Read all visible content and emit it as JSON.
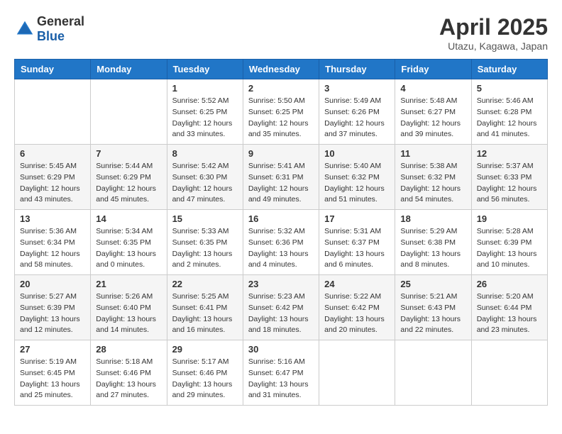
{
  "header": {
    "logo_general": "General",
    "logo_blue": "Blue",
    "title": "April 2025",
    "location": "Utazu, Kagawa, Japan"
  },
  "calendar": {
    "days_of_week": [
      "Sunday",
      "Monday",
      "Tuesday",
      "Wednesday",
      "Thursday",
      "Friday",
      "Saturday"
    ],
    "weeks": [
      [
        {
          "day": "",
          "info": ""
        },
        {
          "day": "",
          "info": ""
        },
        {
          "day": "1",
          "info": "Sunrise: 5:52 AM\nSunset: 6:25 PM\nDaylight: 12 hours\nand 33 minutes."
        },
        {
          "day": "2",
          "info": "Sunrise: 5:50 AM\nSunset: 6:25 PM\nDaylight: 12 hours\nand 35 minutes."
        },
        {
          "day": "3",
          "info": "Sunrise: 5:49 AM\nSunset: 6:26 PM\nDaylight: 12 hours\nand 37 minutes."
        },
        {
          "day": "4",
          "info": "Sunrise: 5:48 AM\nSunset: 6:27 PM\nDaylight: 12 hours\nand 39 minutes."
        },
        {
          "day": "5",
          "info": "Sunrise: 5:46 AM\nSunset: 6:28 PM\nDaylight: 12 hours\nand 41 minutes."
        }
      ],
      [
        {
          "day": "6",
          "info": "Sunrise: 5:45 AM\nSunset: 6:29 PM\nDaylight: 12 hours\nand 43 minutes."
        },
        {
          "day": "7",
          "info": "Sunrise: 5:44 AM\nSunset: 6:29 PM\nDaylight: 12 hours\nand 45 minutes."
        },
        {
          "day": "8",
          "info": "Sunrise: 5:42 AM\nSunset: 6:30 PM\nDaylight: 12 hours\nand 47 minutes."
        },
        {
          "day": "9",
          "info": "Sunrise: 5:41 AM\nSunset: 6:31 PM\nDaylight: 12 hours\nand 49 minutes."
        },
        {
          "day": "10",
          "info": "Sunrise: 5:40 AM\nSunset: 6:32 PM\nDaylight: 12 hours\nand 51 minutes."
        },
        {
          "day": "11",
          "info": "Sunrise: 5:38 AM\nSunset: 6:32 PM\nDaylight: 12 hours\nand 54 minutes."
        },
        {
          "day": "12",
          "info": "Sunrise: 5:37 AM\nSunset: 6:33 PM\nDaylight: 12 hours\nand 56 minutes."
        }
      ],
      [
        {
          "day": "13",
          "info": "Sunrise: 5:36 AM\nSunset: 6:34 PM\nDaylight: 12 hours\nand 58 minutes."
        },
        {
          "day": "14",
          "info": "Sunrise: 5:34 AM\nSunset: 6:35 PM\nDaylight: 13 hours\nand 0 minutes."
        },
        {
          "day": "15",
          "info": "Sunrise: 5:33 AM\nSunset: 6:35 PM\nDaylight: 13 hours\nand 2 minutes."
        },
        {
          "day": "16",
          "info": "Sunrise: 5:32 AM\nSunset: 6:36 PM\nDaylight: 13 hours\nand 4 minutes."
        },
        {
          "day": "17",
          "info": "Sunrise: 5:31 AM\nSunset: 6:37 PM\nDaylight: 13 hours\nand 6 minutes."
        },
        {
          "day": "18",
          "info": "Sunrise: 5:29 AM\nSunset: 6:38 PM\nDaylight: 13 hours\nand 8 minutes."
        },
        {
          "day": "19",
          "info": "Sunrise: 5:28 AM\nSunset: 6:39 PM\nDaylight: 13 hours\nand 10 minutes."
        }
      ],
      [
        {
          "day": "20",
          "info": "Sunrise: 5:27 AM\nSunset: 6:39 PM\nDaylight: 13 hours\nand 12 minutes."
        },
        {
          "day": "21",
          "info": "Sunrise: 5:26 AM\nSunset: 6:40 PM\nDaylight: 13 hours\nand 14 minutes."
        },
        {
          "day": "22",
          "info": "Sunrise: 5:25 AM\nSunset: 6:41 PM\nDaylight: 13 hours\nand 16 minutes."
        },
        {
          "day": "23",
          "info": "Sunrise: 5:23 AM\nSunset: 6:42 PM\nDaylight: 13 hours\nand 18 minutes."
        },
        {
          "day": "24",
          "info": "Sunrise: 5:22 AM\nSunset: 6:42 PM\nDaylight: 13 hours\nand 20 minutes."
        },
        {
          "day": "25",
          "info": "Sunrise: 5:21 AM\nSunset: 6:43 PM\nDaylight: 13 hours\nand 22 minutes."
        },
        {
          "day": "26",
          "info": "Sunrise: 5:20 AM\nSunset: 6:44 PM\nDaylight: 13 hours\nand 23 minutes."
        }
      ],
      [
        {
          "day": "27",
          "info": "Sunrise: 5:19 AM\nSunset: 6:45 PM\nDaylight: 13 hours\nand 25 minutes."
        },
        {
          "day": "28",
          "info": "Sunrise: 5:18 AM\nSunset: 6:46 PM\nDaylight: 13 hours\nand 27 minutes."
        },
        {
          "day": "29",
          "info": "Sunrise: 5:17 AM\nSunset: 6:46 PM\nDaylight: 13 hours\nand 29 minutes."
        },
        {
          "day": "30",
          "info": "Sunrise: 5:16 AM\nSunset: 6:47 PM\nDaylight: 13 hours\nand 31 minutes."
        },
        {
          "day": "",
          "info": ""
        },
        {
          "day": "",
          "info": ""
        },
        {
          "day": "",
          "info": ""
        }
      ]
    ]
  }
}
